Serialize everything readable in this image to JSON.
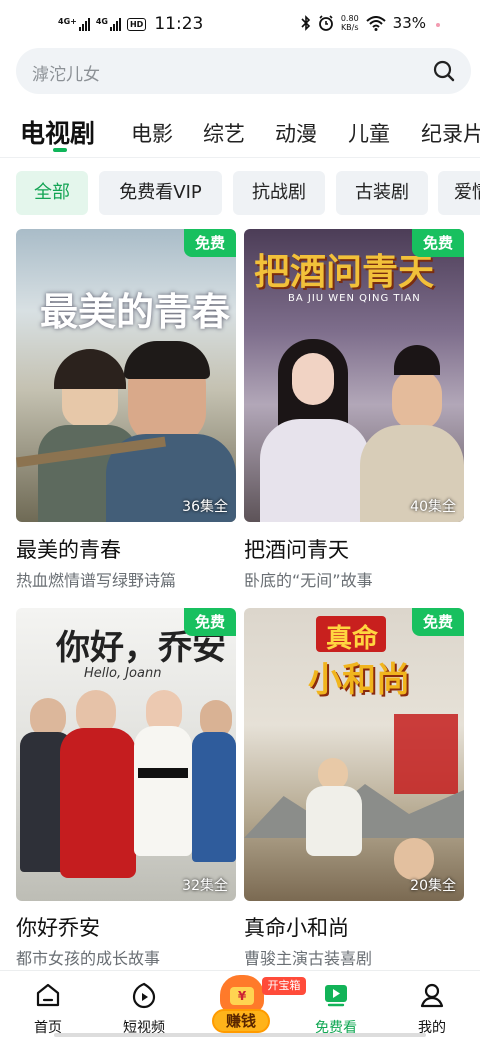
{
  "status": {
    "signal1": "4G+",
    "signal2": "4G",
    "hd": "HD",
    "time": "11:23",
    "net_speed_value": "0.80",
    "net_speed_unit": "KB/s",
    "battery": "33%"
  },
  "search": {
    "placeholder": "滹沱儿女"
  },
  "tabs": [
    "电视剧",
    "电影",
    "综艺",
    "动漫",
    "儿童",
    "纪录片"
  ],
  "chips": [
    "全部",
    "免费看VIP",
    "抗战剧",
    "古装剧",
    "爱情"
  ],
  "cards": [
    {
      "poster_text": "最美的青春",
      "badge": "免费",
      "episodes": "36集全",
      "title": "最美的青春",
      "subtitle": "热血燃情谱写绿野诗篇"
    },
    {
      "poster_text": "把酒问青天",
      "poster_sub": "BA JIU WEN QING TIAN",
      "badge": "免费",
      "episodes": "40集全",
      "title": "把酒问青天",
      "subtitle": "卧底的“无间”故事"
    },
    {
      "poster_text": "你好，乔安",
      "poster_sub": "Hello, Joann",
      "badge": "免费",
      "episodes": "32集全",
      "title": "你好乔安",
      "subtitle": "都市女孩的成长故事"
    },
    {
      "poster_text": "真命",
      "poster_text2": "小和尚",
      "badge": "免费",
      "episodes": "20集全",
      "title": "真命小和尚",
      "subtitle": "曹骏主演古装喜剧"
    }
  ],
  "nav": {
    "home": "首页",
    "short_video": "短视频",
    "earn": "赚钱",
    "treasure": "开宝箱",
    "free_watch": "免费看",
    "mine": "我的"
  },
  "colors": {
    "accent": "#18c05f",
    "chip_active_bg": "#e4f6ec"
  }
}
